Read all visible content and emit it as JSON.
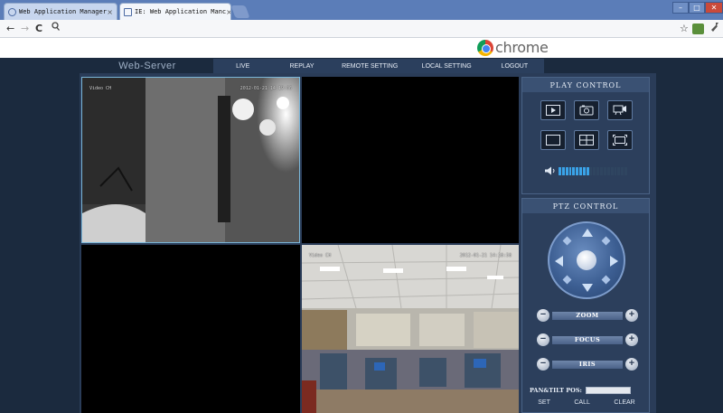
{
  "browser": {
    "tabs": [
      {
        "label": "Web Application Manager"
      },
      {
        "label": "IE: Web Application Manc"
      }
    ],
    "tab_close_glyph": "×",
    "window_controls": [
      "–",
      "□",
      "✕"
    ],
    "url": "",
    "brand": "chrome"
  },
  "app": {
    "title": "Web-Server",
    "menu": [
      "LIVE",
      "REPLAY",
      "REMOTE SETTING",
      "LOCAL SETTING",
      "LOGOUT"
    ],
    "videos": [
      {
        "name": "Video CH",
        "time": "2012-01-21 14:19:06"
      },
      {
        "name": "",
        "time": ""
      },
      {
        "name": "",
        "time": ""
      },
      {
        "name": "Video CH",
        "time": "2012-01-21 14:18:58"
      }
    ]
  },
  "play_control": {
    "title": "PLAY CONTROL",
    "buttons": [
      "play-icon",
      "snapshot-icon",
      "record-icon",
      "single-view-icon",
      "quad-view-icon",
      "fullscreen-icon"
    ],
    "volume_level": 0.45
  },
  "ptz_control": {
    "title": "PTZ CONTROL",
    "rows": [
      {
        "label": "ZOOM",
        "minus": "−",
        "plus": "+"
      },
      {
        "label": "FOCUS",
        "minus": "−",
        "plus": "+"
      },
      {
        "label": "IRIS",
        "minus": "−",
        "plus": "+"
      }
    ],
    "pos_label": "PAN&TILT POS:",
    "pos_value": "",
    "buttons": {
      "set": "SET",
      "call": "CALL",
      "clear": "CLEAR"
    }
  },
  "colors": {
    "accent": "#3aa3e8",
    "panel": "#2c3f5c",
    "tabstrip": "#5b7db8"
  }
}
